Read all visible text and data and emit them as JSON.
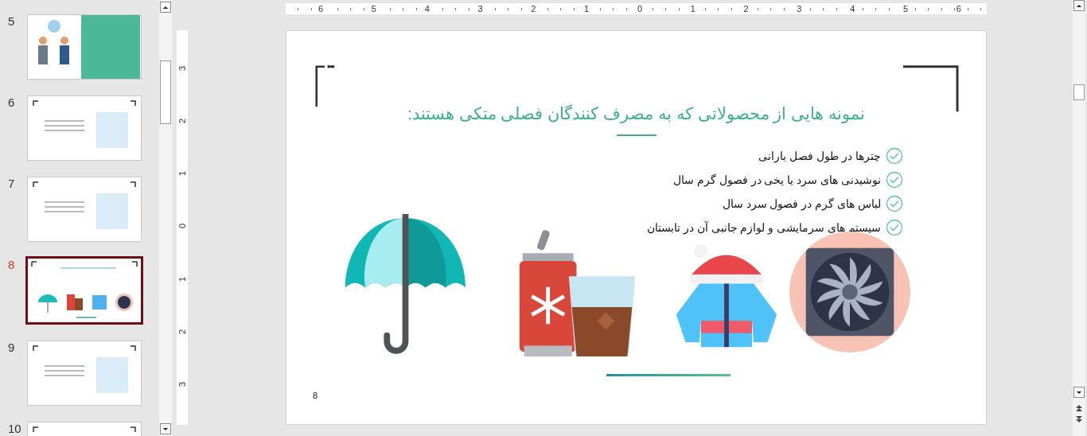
{
  "thumbnails": [
    {
      "number": "5",
      "kind": "people",
      "selected": false
    },
    {
      "number": "6",
      "kind": "bracket",
      "selected": false
    },
    {
      "number": "7",
      "kind": "bracket",
      "selected": false
    },
    {
      "number": "8",
      "kind": "icons",
      "selected": true
    },
    {
      "number": "9",
      "kind": "bracket",
      "selected": false
    },
    {
      "number": "10",
      "kind": "bracket",
      "selected": false
    }
  ],
  "horizontal_ruler": [
    "6",
    "5",
    "4",
    "3",
    "2",
    "1",
    "0",
    "1",
    "2",
    "3",
    "4",
    "5",
    "6"
  ],
  "vertical_ruler": [
    "3",
    "2",
    "1",
    "0",
    "1",
    "2",
    "3"
  ],
  "slide": {
    "title": "نمونه هایی از محصولاتی که به مصرف کنندگان فصلی متکی هستند:",
    "bullets": [
      "چترها در طول فصل بارانی",
      "نوشیدنی های سرد یا یخی در فصول گرم سال",
      "لباس  های گرم در فصول سرد سال",
      "سیستم های سرمایشی و لوازم جانبی آن در تابستان"
    ],
    "illustrations": [
      {
        "kind": "umbrella"
      },
      {
        "kind": "drinks"
      },
      {
        "kind": "jacket"
      },
      {
        "kind": "fan"
      }
    ],
    "slide_number": "8"
  }
}
